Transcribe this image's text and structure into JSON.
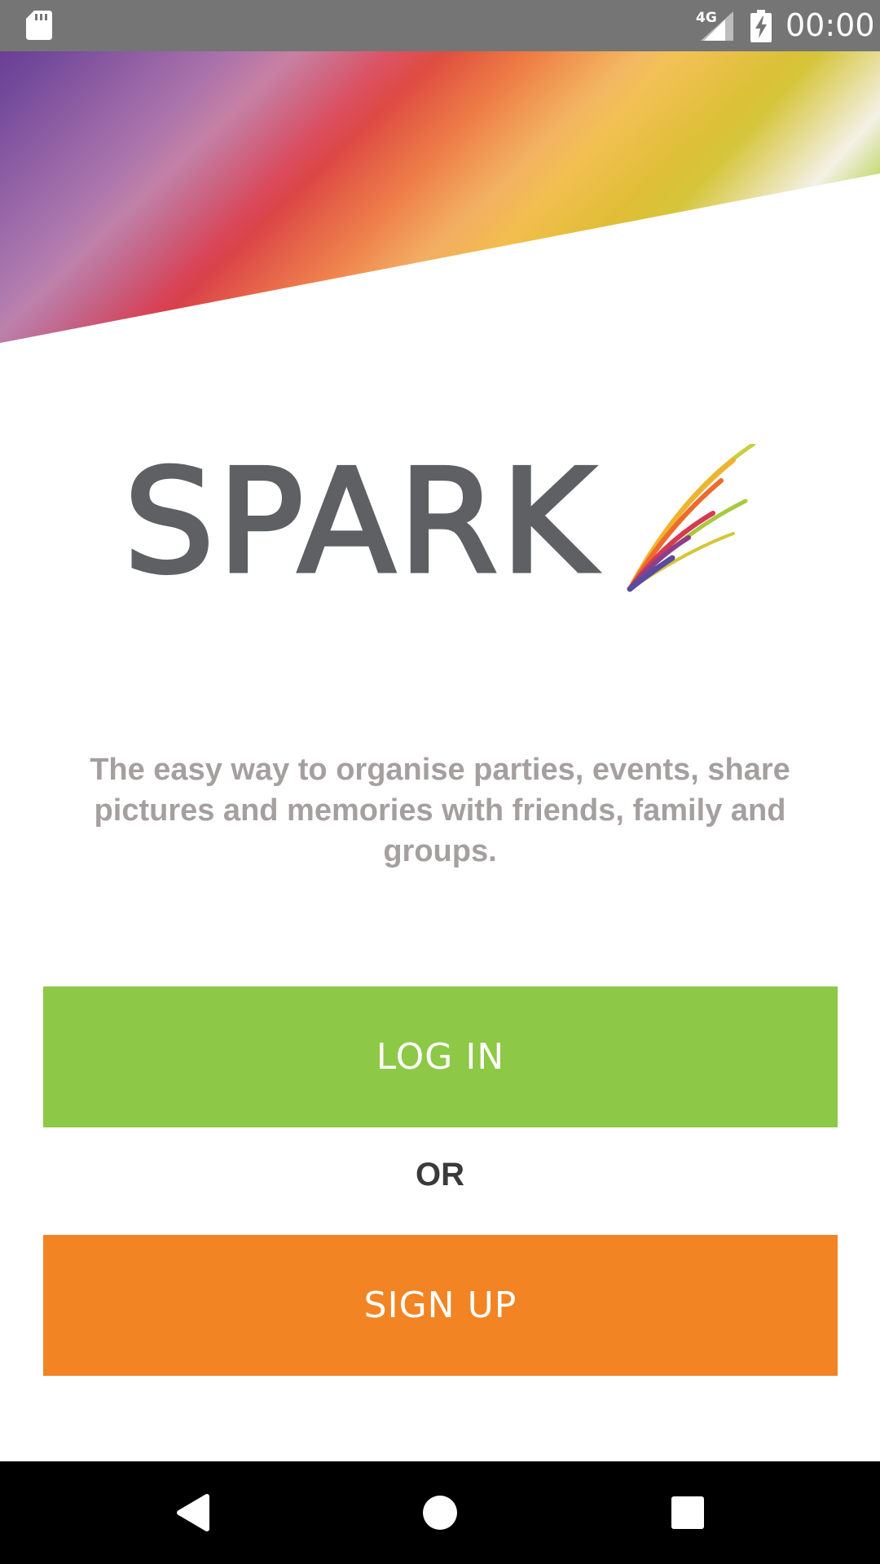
{
  "status_bar": {
    "network_type": "4G",
    "time": "00:00",
    "icons": [
      "sd-card-icon",
      "signal-icon",
      "battery-charging-icon"
    ]
  },
  "app": {
    "logo_text": "SPARK",
    "tagline": "The easy way to organise parties, events, share pictures and memories with friends, family and groups.",
    "login_label": "LOG IN",
    "or_label": "OR",
    "signup_label": "SIGN UP"
  },
  "navigation": {
    "icons": [
      "back-icon",
      "home-icon",
      "recents-icon"
    ]
  },
  "colors": {
    "status_bar": "#757575",
    "login_button": "#8dc846",
    "signup_button": "#f28424",
    "logo_text": "#5f6063",
    "tagline_text": "#a59fa0",
    "or_text": "#3a3a3a",
    "nav_bar": "#000000"
  }
}
